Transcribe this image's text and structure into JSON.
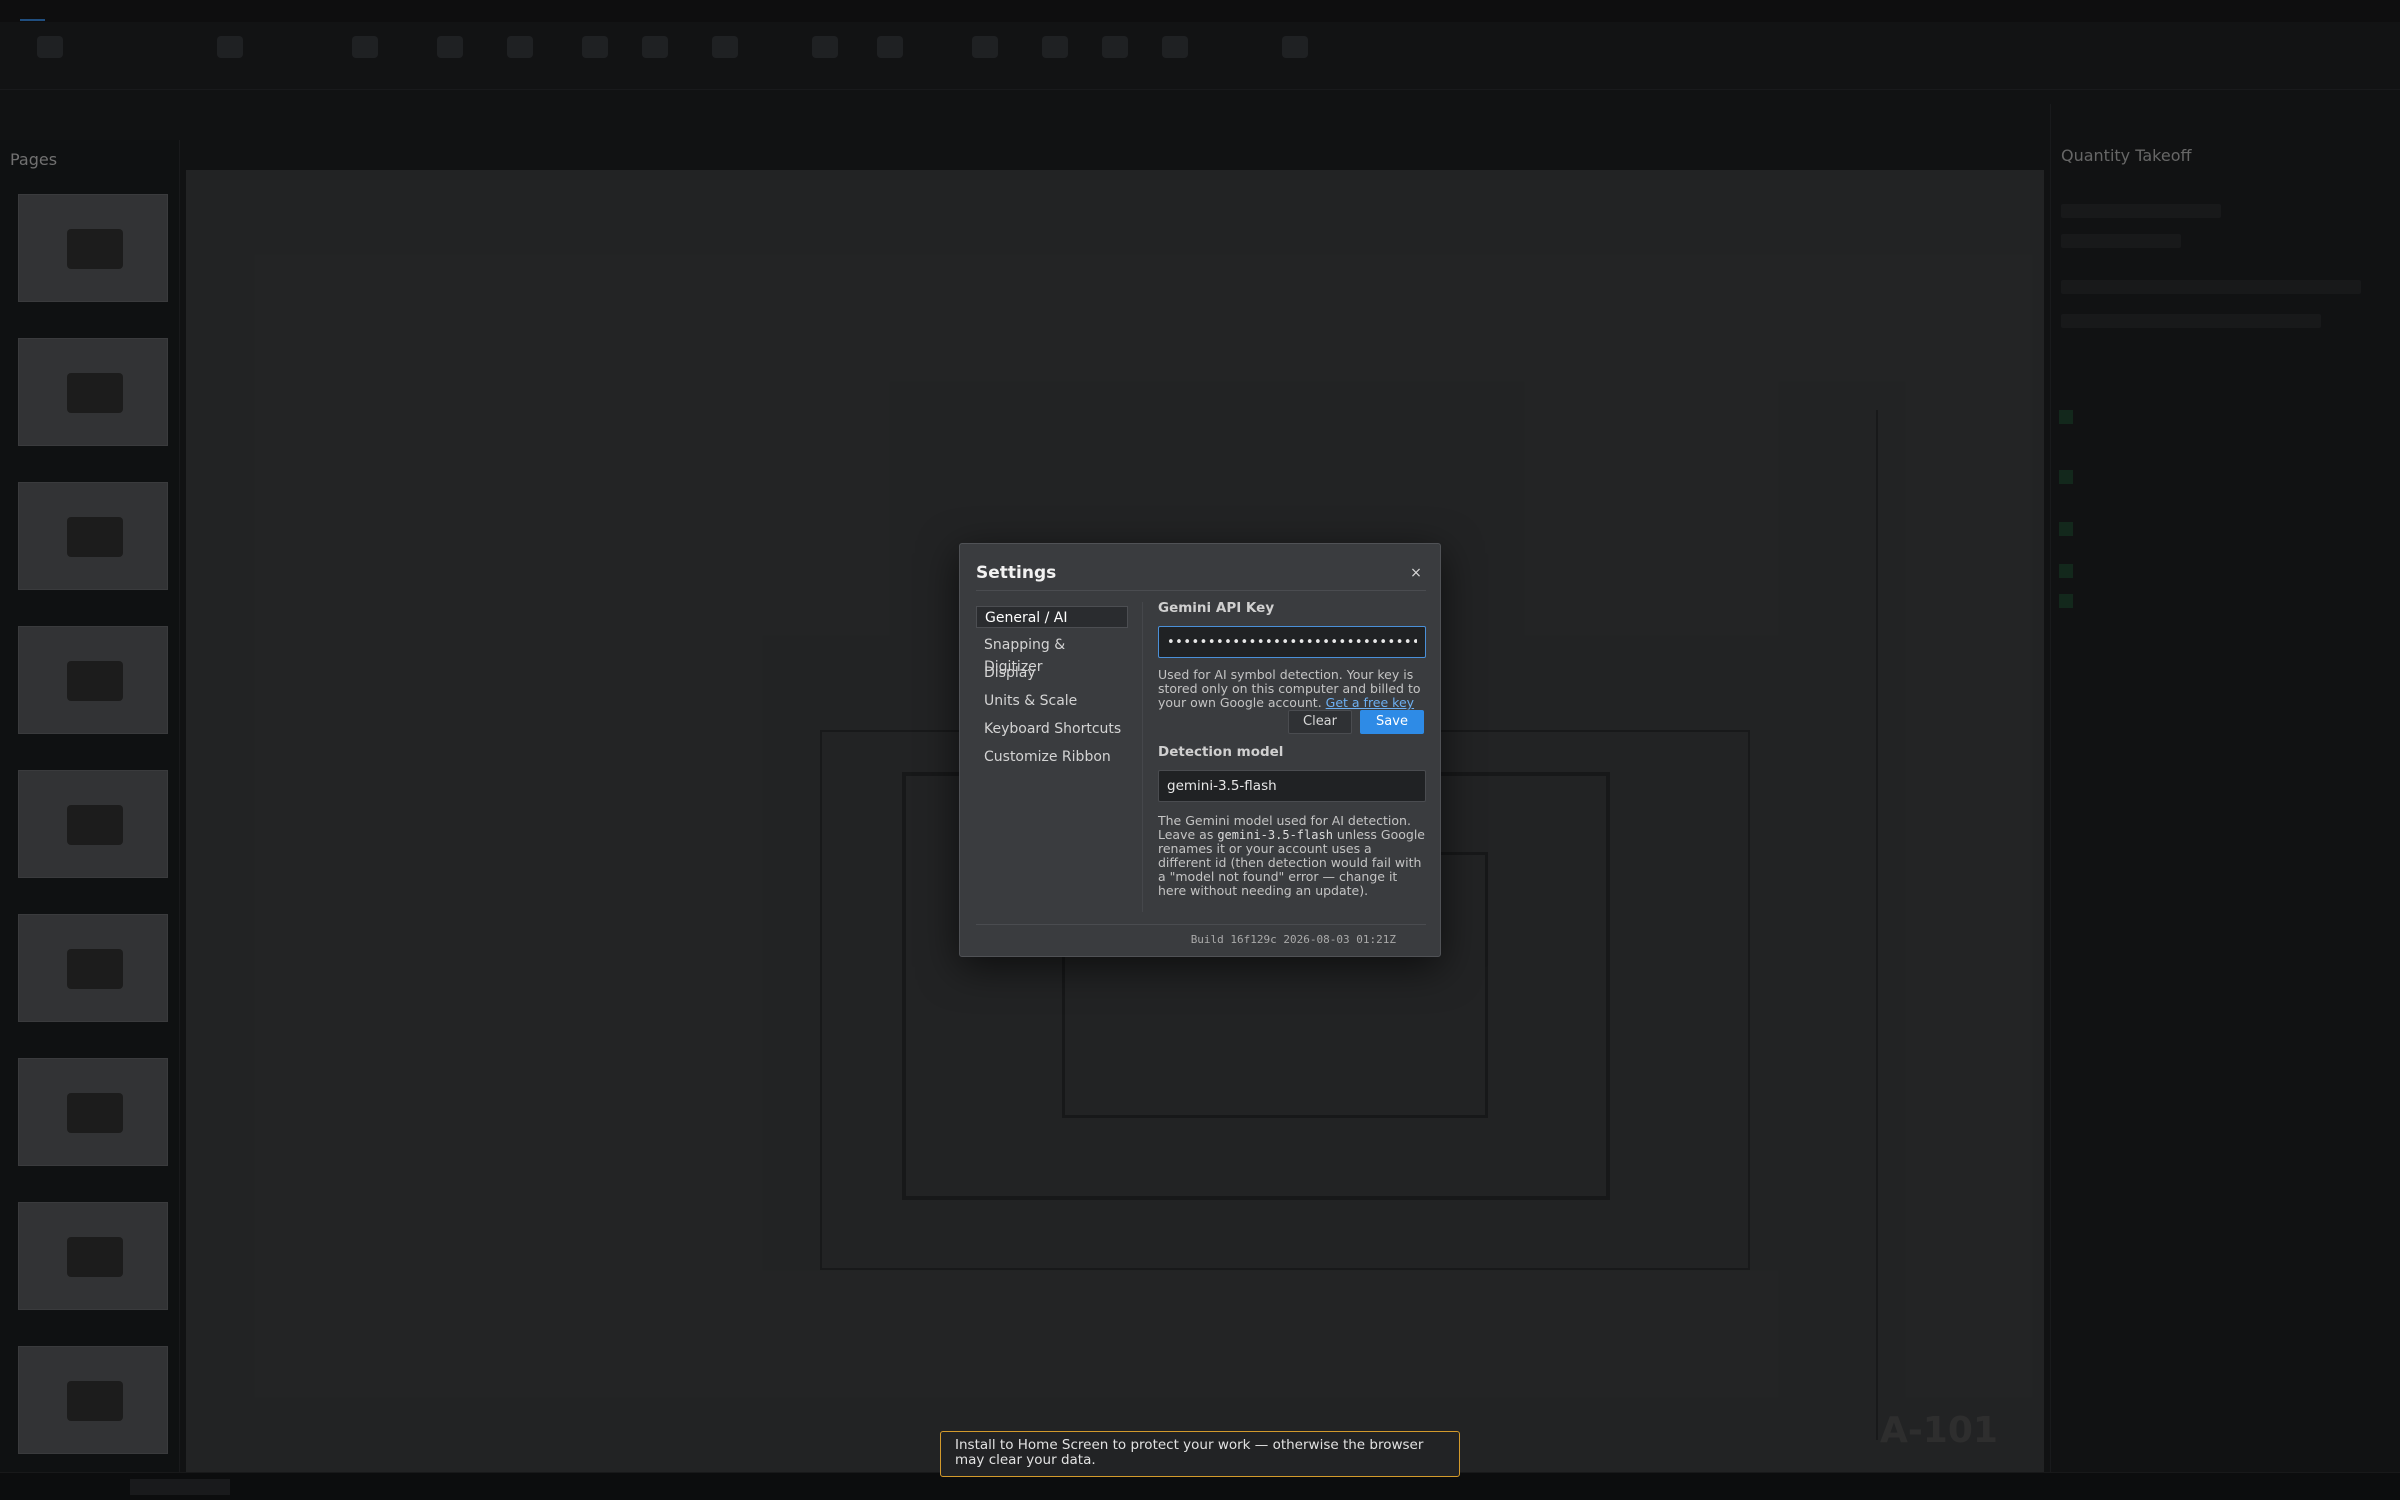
{
  "settings": {
    "title": "Settings",
    "close_glyph": "×",
    "nav": [
      {
        "label": "General / AI",
        "selected": true
      },
      {
        "label": "Snapping & Digitizer",
        "selected": false
      },
      {
        "label": "Display",
        "selected": false
      },
      {
        "label": "Units & Scale",
        "selected": false
      },
      {
        "label": "Keyboard Shortcuts",
        "selected": false
      },
      {
        "label": "Customize Ribbon",
        "selected": false
      }
    ],
    "api_key": {
      "label": "Gemini API Key",
      "value": "••••••••••••••••••••••••••••••••",
      "help": "Used for AI symbol detection. Your key is stored only on this computer and billed to your own Google account.",
      "link": "Get a free key",
      "clear_label": "Clear",
      "save_label": "Save"
    },
    "model": {
      "label": "Detection model",
      "value": "gemini-3.5-flash",
      "help_1": "The Gemini model used for AI detection. Leave as",
      "help_code": "gemini-3.5-flash",
      "help_2": "unless Google renames it or your account uses a different id (then detection would fail with a \"model not found\" error — change it here without needing an update)."
    },
    "build": "Build 16f129c 2026-08-03 01:21Z"
  },
  "toast": {
    "text": "Install to Home Screen to protect your work — otherwise the browser may clear your data."
  },
  "background": {
    "sheet_number": "A-101",
    "panel_title": "Pages",
    "right_panel_title": "Quantity Takeoff"
  },
  "colors": {
    "accent": "#2e8be6",
    "toast_border": "#d39a2c",
    "dialog_bg": "#3a3c3f"
  }
}
